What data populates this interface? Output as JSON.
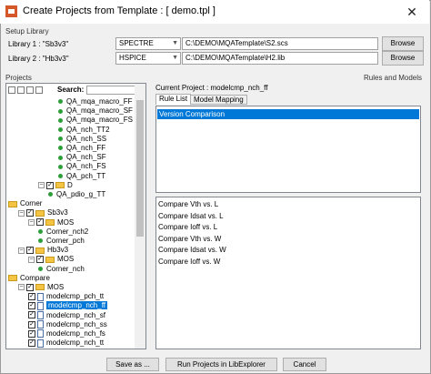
{
  "window": {
    "title": "Create Projects from Template : [ demo.tpl ]",
    "close_glyph": "✕"
  },
  "setup": {
    "group_label": "Setup Library",
    "libraries": [
      {
        "label": "Library 1 : \"Sb3v3\"",
        "simulator": "SPECTRE",
        "path": "C:\\DEMO\\MQATemplate\\S2.scs",
        "browse": "Browse"
      },
      {
        "label": "Library 2 : \"Hb3v3\"",
        "simulator": "HSPICE",
        "path": "C:\\DEMO\\MQATemplate\\H2.lib",
        "browse": "Browse"
      }
    ]
  },
  "projects": {
    "group_label": "Projects",
    "search_label": "Search:",
    "tree": [
      {
        "label": "QA_mqa_macro_FF",
        "type": "leaf",
        "indent": 5
      },
      {
        "label": "QA_mqa_macro_SF",
        "type": "leaf",
        "indent": 5
      },
      {
        "label": "QA_mqa_macro_FS",
        "type": "leaf",
        "indent": 5
      },
      {
        "label": "QA_nch_TT2",
        "type": "leaf",
        "indent": 5
      },
      {
        "label": "QA_nch_SS",
        "type": "leaf",
        "indent": 5
      },
      {
        "label": "QA_nch_FF",
        "type": "leaf",
        "indent": 5
      },
      {
        "label": "QA_nch_SF",
        "type": "leaf",
        "indent": 5
      },
      {
        "label": "QA_nch_FS",
        "type": "leaf",
        "indent": 5
      },
      {
        "label": "QA_pch_TT",
        "type": "leaf",
        "indent": 5
      },
      {
        "label": "D",
        "type": "folder",
        "indent": 3
      },
      {
        "label": "QA_pdio_g_TT",
        "type": "leaf",
        "indent": 4
      },
      {
        "label": "Corner",
        "type": "root",
        "indent": 0
      },
      {
        "label": "Sb3v3",
        "type": "folder",
        "indent": 1
      },
      {
        "label": "MOS",
        "type": "folder",
        "indent": 2
      },
      {
        "label": "Corner_nch2",
        "type": "leaf",
        "indent": 3
      },
      {
        "label": "Corner_pch",
        "type": "leaf",
        "indent": 3
      },
      {
        "label": "Hb3v3",
        "type": "folder",
        "indent": 1
      },
      {
        "label": "MOS",
        "type": "folder",
        "indent": 2
      },
      {
        "label": "Corner_nch",
        "type": "leaf",
        "indent": 3
      },
      {
        "label": "Compare",
        "type": "root",
        "indent": 0
      },
      {
        "label": "MOS",
        "type": "folder",
        "indent": 1
      },
      {
        "label": "modelcmp_pch_tt",
        "type": "doc",
        "indent": 2
      },
      {
        "label": "modelcmp_nch_ff",
        "type": "doc",
        "indent": 2,
        "selected": true
      },
      {
        "label": "modelcmp_nch_sf",
        "type": "doc",
        "indent": 2
      },
      {
        "label": "modelcmp_nch_ss",
        "type": "doc",
        "indent": 2
      },
      {
        "label": "modelcmp_nch_fs",
        "type": "doc",
        "indent": 2
      },
      {
        "label": "modelcmp_nch_tt",
        "type": "doc",
        "indent": 2
      }
    ]
  },
  "rules": {
    "group_label": "Rules and Models",
    "current_project": "Current Project : modelcmp_nch_ff",
    "tabs": [
      "Rule List",
      "Model Mapping"
    ],
    "rule_list": [
      "Version Comparison"
    ],
    "rule_items": [
      "Compare Vth vs. L",
      "Compare Idsat vs. L",
      "Compare Ioff vs. L",
      "Compare Vth vs. W",
      "Compare Idsat vs. W",
      "Compare Ioff vs. W"
    ]
  },
  "buttons": {
    "save_as": "Save as ...",
    "run": "Run Projects in LibExplorer",
    "cancel": "Cancel"
  }
}
